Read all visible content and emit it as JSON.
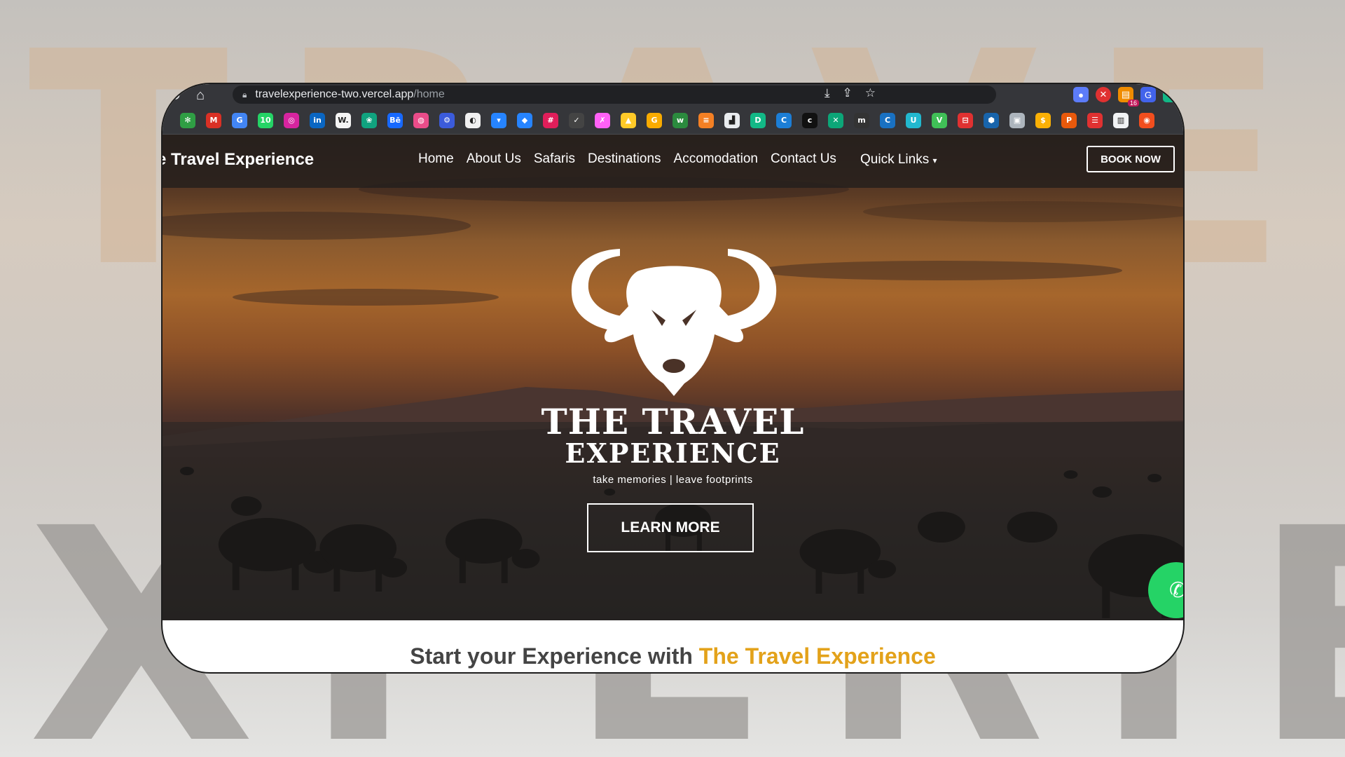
{
  "background": {
    "row1": "TRAVEL",
    "row2": "XPERIE"
  },
  "browser": {
    "url_host": "travelexperience-two.vercel.app",
    "url_path": "/home",
    "extension_badge": "16"
  },
  "bookmarks": [
    {
      "icon": "pinwheel-icon",
      "glyph": "✻",
      "color": "#2f9e44"
    },
    {
      "icon": "gmail-icon",
      "glyph": "M",
      "color": "#d93025"
    },
    {
      "icon": "translate-icon",
      "glyph": "G",
      "color": "#4285f4"
    },
    {
      "icon": "whatsapp-icon",
      "glyph": "10",
      "color": "#25d366"
    },
    {
      "icon": "instagram-icon",
      "glyph": "◎",
      "color": "#d6249f"
    },
    {
      "icon": "linkedin-icon",
      "glyph": "in",
      "color": "#0a66c2"
    },
    {
      "icon": "webflow-icon",
      "glyph": "W.",
      "color": "#f4f4f4"
    },
    {
      "icon": "chatgpt-icon",
      "glyph": "❀",
      "color": "#10a37f"
    },
    {
      "icon": "behance-icon",
      "glyph": "Bē",
      "color": "#1769ff"
    },
    {
      "icon": "dribbble-icon",
      "glyph": "◍",
      "color": "#ea4c89"
    },
    {
      "icon": "gear-bookmark-icon",
      "glyph": "⚙",
      "color": "#3b5bdb"
    },
    {
      "icon": "github-icon",
      "glyph": "◐",
      "color": "#f0f0f0"
    },
    {
      "icon": "bitbucket-icon",
      "glyph": "▾",
      "color": "#2684ff"
    },
    {
      "icon": "jira-icon",
      "glyph": "◆",
      "color": "#2684ff"
    },
    {
      "icon": "slack-icon",
      "glyph": "#",
      "color": "#e01e5a"
    },
    {
      "icon": "check-circle-icon",
      "glyph": "✓",
      "color": "#444"
    },
    {
      "icon": "xd-icon",
      "glyph": "✗",
      "color": "#ff61f6"
    },
    {
      "icon": "firebase-icon",
      "glyph": "▲",
      "color": "#ffca28"
    },
    {
      "icon": "google-icon",
      "glyph": "G",
      "color": "#f9ab00"
    },
    {
      "icon": "w-icon",
      "glyph": "w",
      "color": "#2b8a3e"
    },
    {
      "icon": "stackoverflow-icon",
      "glyph": "≡",
      "color": "#f48024"
    },
    {
      "icon": "building-icon",
      "glyph": "▟",
      "color": "#e9ecef"
    },
    {
      "icon": "d-icon",
      "glyph": "D",
      "color": "#12b886"
    },
    {
      "icon": "c-circle-icon",
      "glyph": "C",
      "color": "#1c7ed6"
    },
    {
      "icon": "c-black-icon",
      "glyph": "c",
      "color": "#111"
    },
    {
      "icon": "x-green-icon",
      "glyph": "✕",
      "color": "#0ca678"
    },
    {
      "icon": "m-icon",
      "glyph": "m",
      "color": "#333"
    },
    {
      "icon": "c-blue-icon",
      "glyph": "C",
      "color": "#1971c2"
    },
    {
      "icon": "u-icon",
      "glyph": "U",
      "color": "#22b8cf"
    },
    {
      "icon": "v-icon",
      "glyph": "V",
      "color": "#40c057"
    },
    {
      "icon": "red-box-icon",
      "glyph": "⊟",
      "color": "#e03131"
    },
    {
      "icon": "hex-icon",
      "glyph": "⬢",
      "color": "#1864ab"
    },
    {
      "icon": "cube-icon",
      "glyph": "▣",
      "color": "#adb5bd"
    },
    {
      "icon": "coin-icon",
      "glyph": "$",
      "color": "#fab005"
    },
    {
      "icon": "p-icon",
      "glyph": "P",
      "color": "#e8590c"
    },
    {
      "icon": "list-icon",
      "glyph": "☰",
      "color": "#e03131"
    },
    {
      "icon": "piano-icon",
      "glyph": "▥",
      "color": "#f1f3f5"
    },
    {
      "icon": "figma-icon",
      "glyph": "◉",
      "color": "#f24e1e"
    }
  ],
  "nav": {
    "brand": "e Travel Experience",
    "links": [
      "Home",
      "About Us",
      "Safaris",
      "Destinations",
      "Accomodation",
      "Contact Us"
    ],
    "quick_links": "Quick Links",
    "book_now": "BOOK NOW"
  },
  "hero": {
    "title_line1": "THE TRAVEL",
    "title_line2": "EXPERIENCE",
    "tagline": "take memories | leave footprints",
    "cta": "LEARN MORE"
  },
  "section": {
    "heading_plain": "Start your Experience with ",
    "heading_accent": "The Travel Experience"
  }
}
